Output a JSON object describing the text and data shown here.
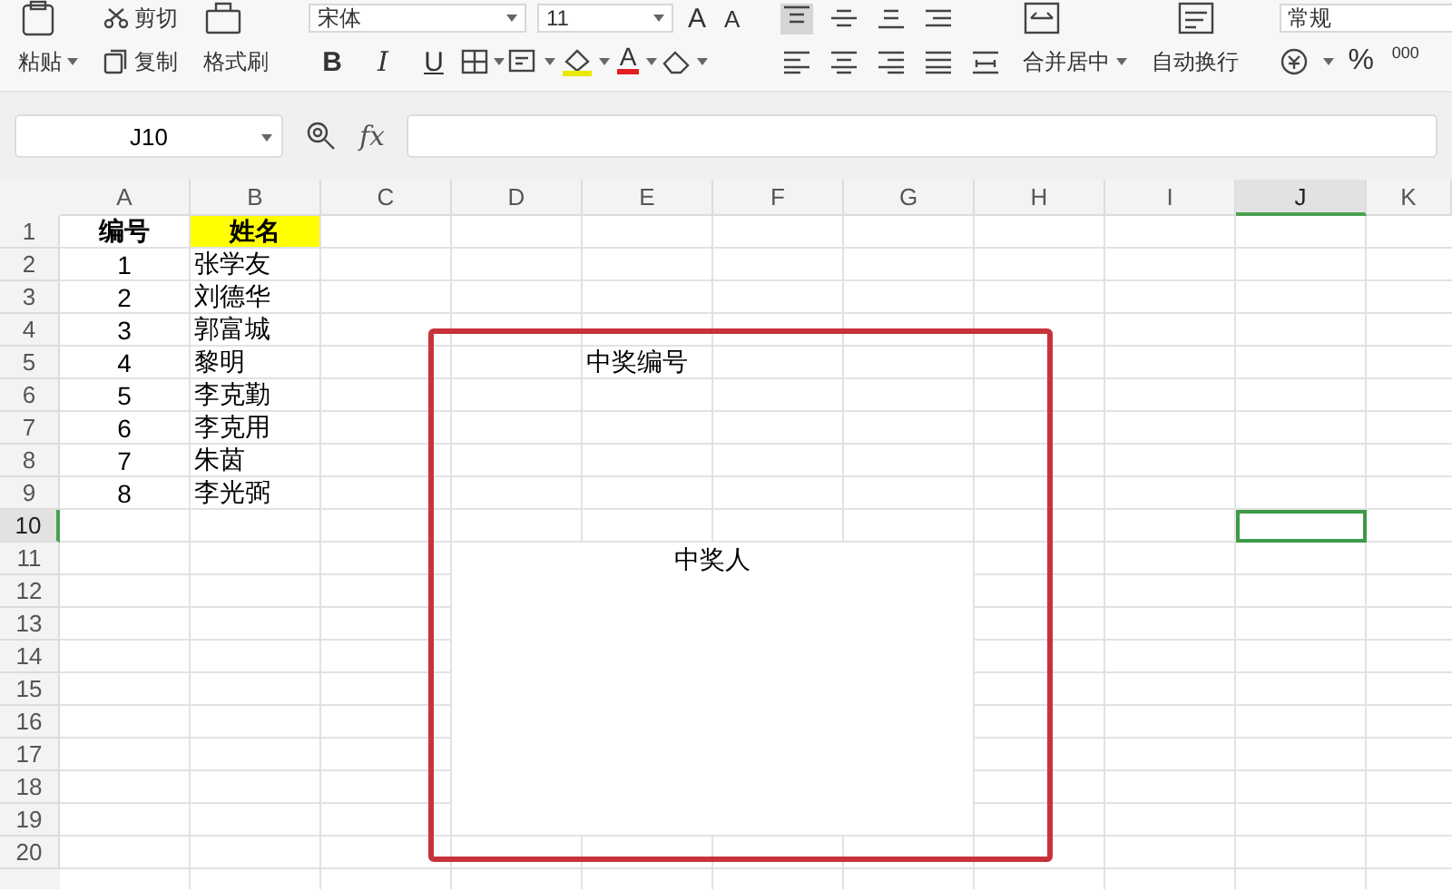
{
  "ribbon": {
    "cut": "剪切",
    "paste": "粘贴",
    "copy": "复制",
    "format_painter": "格式刷",
    "font_name": "宋体",
    "font_size": "11",
    "grow_font": "A",
    "shrink_font": "A",
    "bold": "B",
    "italic": "I",
    "underline": "U",
    "font_color": "A",
    "merge": "合并居中",
    "wrap": "自动换行",
    "number_format": "常规",
    "percent": "%",
    "thousands": "000"
  },
  "formula_bar": {
    "name_box": "J10",
    "fx": "fx"
  },
  "columns": [
    {
      "label": "A",
      "selected": false
    },
    {
      "label": "B",
      "selected": false
    },
    {
      "label": "C",
      "selected": false
    },
    {
      "label": "D",
      "selected": false
    },
    {
      "label": "E",
      "selected": false
    },
    {
      "label": "F",
      "selected": false
    },
    {
      "label": "G",
      "selected": false
    },
    {
      "label": "H",
      "selected": false
    },
    {
      "label": "I",
      "selected": false
    },
    {
      "label": "J",
      "selected": true
    },
    {
      "label": "K",
      "selected": false
    }
  ],
  "rows": [
    {
      "number": "1",
      "selected": false,
      "cells": {
        "A": {
          "text": "编号",
          "kind": "header"
        },
        "B": {
          "text": "姓名",
          "kind": "highlight"
        }
      }
    },
    {
      "number": "2",
      "selected": false,
      "cells": {
        "A": {
          "text": "1",
          "kind": "number"
        },
        "B": {
          "text": "张学友",
          "kind": "text"
        }
      }
    },
    {
      "number": "3",
      "selected": false,
      "cells": {
        "A": {
          "text": "2",
          "kind": "number"
        },
        "B": {
          "text": "刘德华",
          "kind": "text"
        }
      }
    },
    {
      "number": "4",
      "selected": false,
      "cells": {
        "A": {
          "text": "3",
          "kind": "number"
        },
        "B": {
          "text": "郭富城",
          "kind": "text"
        }
      }
    },
    {
      "number": "5",
      "selected": false,
      "cells": {
        "A": {
          "text": "4",
          "kind": "number"
        },
        "B": {
          "text": "黎明",
          "kind": "text"
        },
        "E": {
          "text": "中奖编号",
          "kind": "text"
        }
      }
    },
    {
      "number": "6",
      "selected": false,
      "cells": {
        "A": {
          "text": "5",
          "kind": "number"
        },
        "B": {
          "text": "李克勤",
          "kind": "text"
        }
      }
    },
    {
      "number": "7",
      "selected": false,
      "cells": {
        "A": {
          "text": "6",
          "kind": "number"
        },
        "B": {
          "text": "李克用",
          "kind": "text"
        }
      }
    },
    {
      "number": "8",
      "selected": false,
      "cells": {
        "A": {
          "text": "7",
          "kind": "number"
        },
        "B": {
          "text": "朱茵",
          "kind": "text"
        }
      }
    },
    {
      "number": "9",
      "selected": false,
      "cells": {
        "A": {
          "text": "8",
          "kind": "number"
        },
        "B": {
          "text": "李光弼",
          "kind": "text"
        }
      }
    },
    {
      "number": "10",
      "selected": true
    },
    {
      "number": "11",
      "selected": false,
      "cells": {
        "D": {
          "text": "中奖人",
          "kind": "merged"
        }
      }
    },
    {
      "number": "12",
      "selected": false
    },
    {
      "number": "13",
      "selected": false
    },
    {
      "number": "14",
      "selected": false
    },
    {
      "number": "15",
      "selected": false
    },
    {
      "number": "16",
      "selected": false
    },
    {
      "number": "17",
      "selected": false
    },
    {
      "number": "18",
      "selected": false
    },
    {
      "number": "19",
      "selected": false
    },
    {
      "number": "20",
      "selected": false
    }
  ]
}
